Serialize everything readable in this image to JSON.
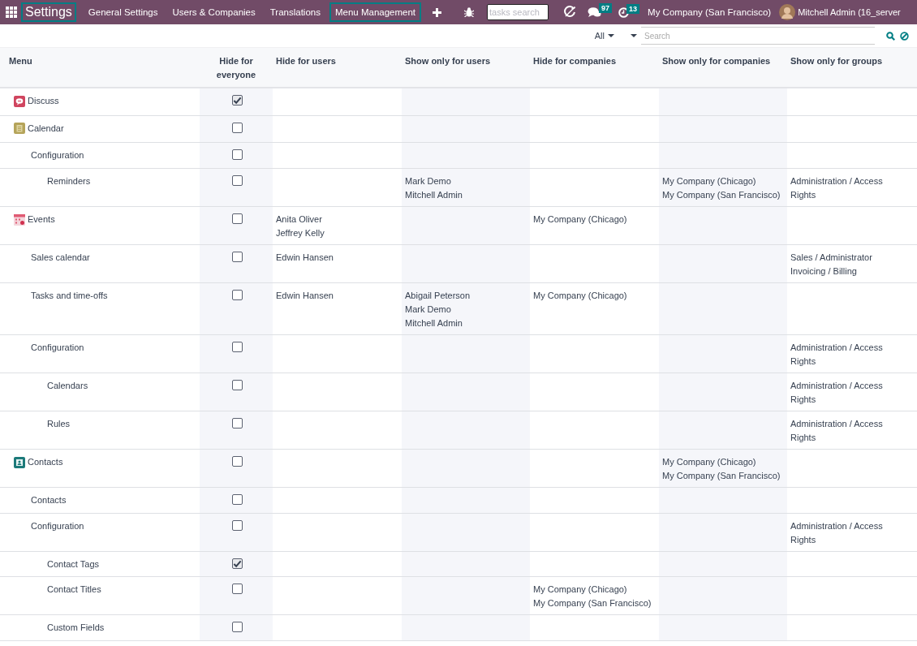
{
  "navbar": {
    "app_name": {
      "label": "Settings",
      "outlined": true
    },
    "items": [
      {
        "label": "General Settings",
        "outlined": false
      },
      {
        "label": "Users & Companies",
        "outlined": false
      },
      {
        "label": "Translations",
        "outlined": false
      },
      {
        "label": "Menu Management",
        "outlined": true
      }
    ],
    "tasks_search": {
      "placeholder": "tasks search"
    },
    "messages_badge": "97",
    "activities_badge": "13",
    "company": "My Company (San Francisco)",
    "user": "Mitchell Admin (16_server"
  },
  "control_panel": {
    "filter": "All",
    "search": {
      "placeholder": "Search"
    }
  },
  "table": {
    "columns": [
      "Menu",
      "Hide for everyone",
      "Hide for users",
      "Show only for users",
      "Hide for companies",
      "Show only for companies",
      "Show only for groups"
    ],
    "rows": [
      {
        "name": "Discuss",
        "hide_for_everyone": true
      },
      {
        "name": "Calendar",
        "hide_for_everyone": false,
        "children": [
          {
            "name": "Configuration",
            "hide_for_everyone": false,
            "children": [
              {
                "name": "Reminders",
                "hide_for_everyone": false,
                "show_only_for_users": [
                  "Mark Demo",
                  "Mitchell Admin"
                ],
                "show_only_for_companies": [
                  "My Company (Chicago)",
                  "My Company (San Francisco)"
                ],
                "show_only_for_groups": [
                  "Administration / Access Rights"
                ]
              }
            ]
          }
        ]
      },
      {
        "name": "Events",
        "hide_for_everyone": false,
        "hide_for_users": [
          "Anita Oliver",
          "Jeffrey Kelly"
        ],
        "hide_for_companies": [
          "My Company (Chicago)"
        ],
        "children": [
          {
            "name": "Sales calendar",
            "hide_for_everyone": false,
            "hide_for_users": [
              "Edwin Hansen"
            ],
            "show_only_for_groups": [
              "Sales / Administrator",
              "Invoicing / Billing"
            ]
          },
          {
            "name": "Tasks and time-offs",
            "hide_for_everyone": false,
            "hide_for_users": [
              "Edwin Hansen"
            ],
            "show_only_for_users": [
              "Abigail Peterson",
              "Mark Demo",
              "Mitchell Admin"
            ],
            "hide_for_companies": [
              "My Company (Chicago)"
            ]
          },
          {
            "name": "Configuration",
            "hide_for_everyone": false,
            "show_only_for_groups": [
              "Administration / Access Rights"
            ],
            "children": [
              {
                "name": "Calendars",
                "hide_for_everyone": false,
                "show_only_for_groups": [
                  "Administration / Access Rights"
                ]
              },
              {
                "name": "Rules",
                "hide_for_everyone": false,
                "show_only_for_groups": [
                  "Administration / Access Rights"
                ]
              }
            ]
          }
        ]
      },
      {
        "name": "Contacts",
        "hide_for_everyone": false,
        "show_only_for_companies": [
          "My Company (Chicago)",
          "My Company (San Francisco)"
        ],
        "children": [
          {
            "name": "Contacts",
            "hide_for_everyone": false
          },
          {
            "name": "Configuration",
            "hide_for_everyone": false,
            "show_only_for_groups": [
              "Administration / Access Rights"
            ],
            "children": [
              {
                "name": "Contact Tags",
                "hide_for_everyone": true
              },
              {
                "name": "Contact Titles",
                "hide_for_everyone": false,
                "hide_for_companies": [
                  "My Company (Chicago)",
                  "My Company (San Francisco)"
                ]
              },
              {
                "name": "Custom Fields",
                "hide_for_everyone": false
              }
            ]
          }
        ]
      }
    ]
  }
}
